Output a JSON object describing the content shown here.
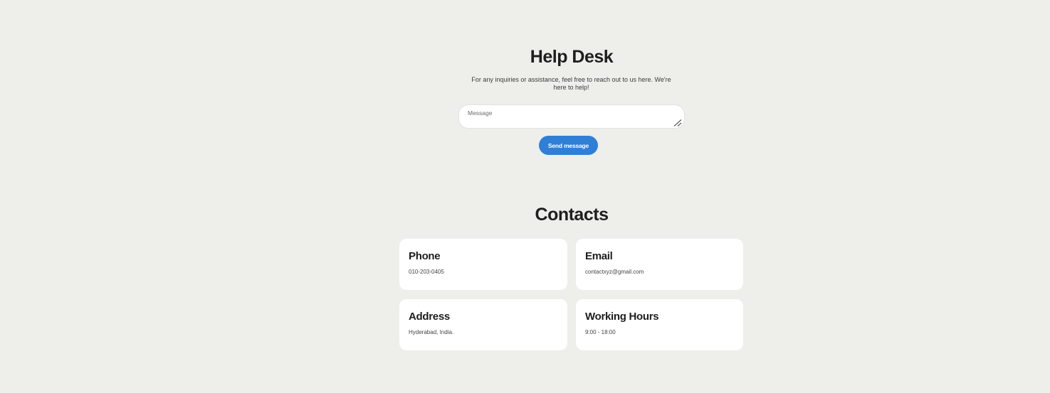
{
  "help_desk": {
    "title": "Help Desk",
    "subtitle": "For any inquiries or assistance, feel free to reach out to us here. We're here to help!",
    "message_placeholder": "Message",
    "message_value": "",
    "send_button_label": "Send message"
  },
  "contacts": {
    "title": "Contacts",
    "cards": [
      {
        "title": "Phone",
        "value": "010-203-0405"
      },
      {
        "title": "Email",
        "value": "contactxyz@gmail.com"
      },
      {
        "title": "Address",
        "value": "Hyderabad, India."
      },
      {
        "title": "Working Hours",
        "value": "9:00 - 18:00"
      }
    ]
  },
  "colors": {
    "background": "#eeeeea",
    "card_background": "#ffffff",
    "accent": "#2f7fd6",
    "text": "#1e1e1e"
  }
}
